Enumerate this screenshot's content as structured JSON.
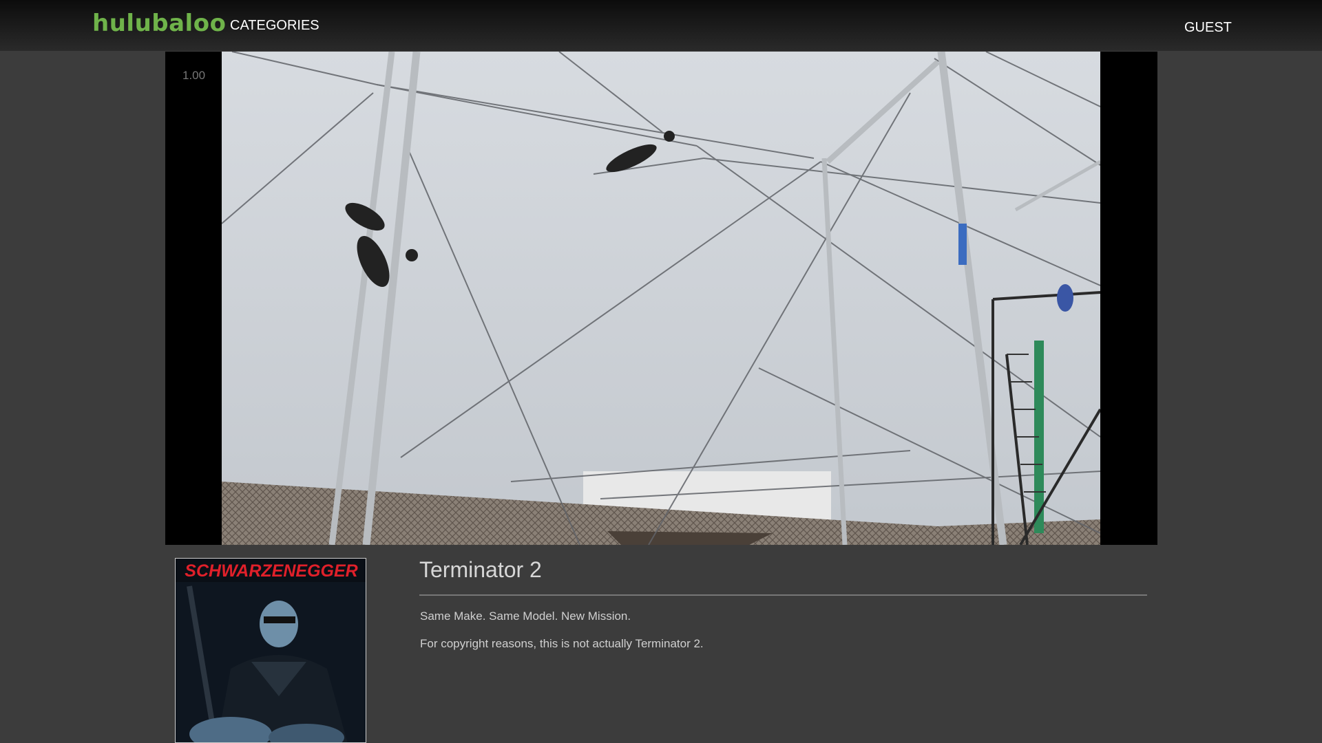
{
  "header": {
    "logo_text": "hulubaloo",
    "categories_label": "CATEGORIES",
    "user_label": "GUEST",
    "logo_color": "#6fb34a"
  },
  "player": {
    "playback_rate": "1.00"
  },
  "movie": {
    "title": "Terminator 2",
    "tagline": "Same Make. Same Model. New Mission.",
    "note": "For copyright reasons, this is not actually Terminator 2.",
    "poster_text": "SCHWARZENEGGER",
    "poster_text_color": "#e0202a"
  }
}
